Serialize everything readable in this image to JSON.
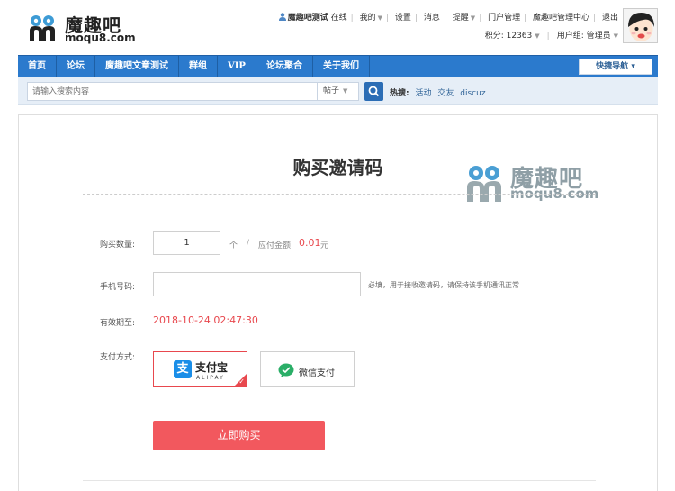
{
  "header": {
    "logo_cn": "魔趣吧",
    "logo_en": "moqu8.com",
    "username": "魔趣吧测试",
    "status": "在线",
    "links": [
      "我的",
      "设置",
      "消息",
      "提醒",
      "门户管理",
      "魔趣吧管理中心",
      "退出"
    ],
    "points_label": "积分: 12363",
    "usergroup_label": "用户组: 管理员"
  },
  "nav": {
    "items": [
      "首页",
      "论坛",
      "魔趣吧文章测试",
      "群组",
      "VIP",
      "论坛聚合",
      "关于我们"
    ],
    "quick_nav": "快捷导航"
  },
  "search": {
    "placeholder": "请输入搜索内容",
    "type": "帖子",
    "hot_label": "热搜:",
    "hot_links": [
      "活动",
      "交友",
      "discuz"
    ]
  },
  "form": {
    "title": "购买邀请码",
    "watermark_cn": "魔趣吧",
    "watermark_en": "moqu8.com",
    "qty_label": "购买数量:",
    "qty_value": "1",
    "unit": "个",
    "slash": "/",
    "amount_label": "应付金额:",
    "amount_value": "0.01",
    "amount_unit": "元",
    "phone_label": "手机号码:",
    "phone_value": "",
    "phone_hint": "必填，用于接收邀请码，请保持该手机通讯正常",
    "expire_label": "有效期至:",
    "expire_value": "2018-10-24 02:47:30",
    "pay_label": "支付方式:",
    "alipay_text": "支付宝",
    "alipay_sub": "ALIPAY",
    "wechat_text": "微信支付",
    "buy_button": "立即购买"
  },
  "colors": {
    "nav_bg": "#2b7acd",
    "accent_red": "#e8484e",
    "button_red": "#f2585e",
    "alipay_blue": "#1a8ee8",
    "wechat_green": "#2aae67"
  }
}
